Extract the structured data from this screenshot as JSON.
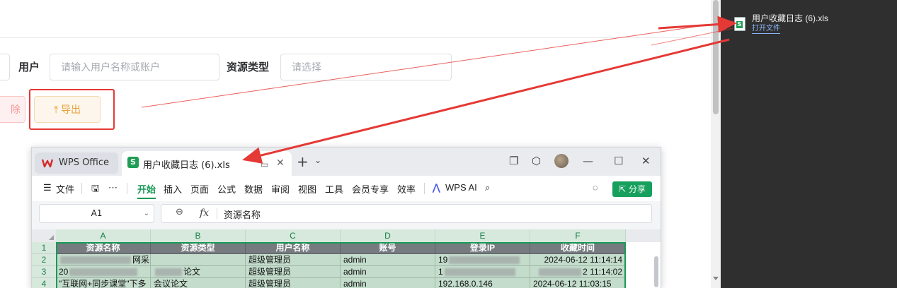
{
  "page": {
    "filters": {
      "user_label": "用户",
      "user_placeholder": "请输入用户名称或账户",
      "type_label": "资源类型",
      "type_placeholder": "请选择"
    },
    "buttons": {
      "delete_label": "除",
      "export_label": "导出",
      "export_icon": "upload-icon"
    }
  },
  "download": {
    "file_name": "用户收藏日志 (6).xls",
    "open_label": "打开文件"
  },
  "wps": {
    "home_tab": "WPS Office",
    "file_tab": "用户收藏日志 (6).xls",
    "menu": [
      "文件",
      "开始",
      "插入",
      "页面",
      "公式",
      "数据",
      "审阅",
      "视图",
      "工具",
      "会员专享",
      "效率"
    ],
    "ai_label": "WPS AI",
    "share_label": "分享",
    "name_box": "A1",
    "formula_value": "资源名称",
    "columns": [
      "A",
      "B",
      "C",
      "D",
      "E",
      "F"
    ],
    "rows": [
      "1",
      "2",
      "3",
      "4"
    ],
    "headers": [
      "资源名称",
      "资源类型",
      "用户名称",
      "账号",
      "登录IP",
      "收藏时间"
    ],
    "data": [
      [
        "网采",
        "",
        "超级管理员",
        "admin",
        "19",
        "2024-06-12 11:14:14"
      ],
      [
        "20",
        "论文",
        "超级管理员",
        "admin",
        "1",
        "2 11:14:02"
      ],
      [
        "\"互联网+同步课堂\"下多",
        "会议论文",
        "超级管理员",
        "admin",
        "192.168.0.146",
        "2024-06-12 11:03:15"
      ]
    ]
  },
  "colors": {
    "accent_green": "#1a9a58",
    "annotation_red": "#e53935",
    "export_orange": "#e6a23c"
  }
}
